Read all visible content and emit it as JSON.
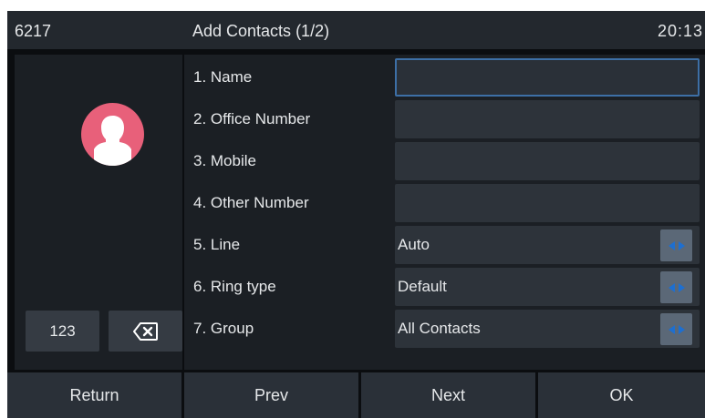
{
  "titlebar": {
    "extension": "6217",
    "title": "Add Contacts (1/2)",
    "time": "20:13"
  },
  "keypad": {
    "mode_label": "123",
    "delete_icon": "backspace-icon"
  },
  "avatar": {
    "icon": "person-icon",
    "color": "#e8607a"
  },
  "form": {
    "rows": [
      {
        "label": "1. Name",
        "value": "",
        "type": "text",
        "focused": true
      },
      {
        "label": "2. Office Number",
        "value": "",
        "type": "text"
      },
      {
        "label": "3. Mobile",
        "value": "",
        "type": "text"
      },
      {
        "label": "4. Other Number",
        "value": "",
        "type": "text"
      },
      {
        "label": "5. Line",
        "value": "Auto",
        "type": "select"
      },
      {
        "label": "6. Ring type",
        "value": "Default",
        "type": "select"
      },
      {
        "label": "7. Group",
        "value": "All Contacts",
        "type": "select"
      }
    ]
  },
  "softkeys": [
    "Return",
    "Prev",
    "Next",
    "OK"
  ],
  "colors": {
    "accent": "#3d6fa6",
    "arrow": "#1e6fd0",
    "background": "#0b0d10"
  }
}
